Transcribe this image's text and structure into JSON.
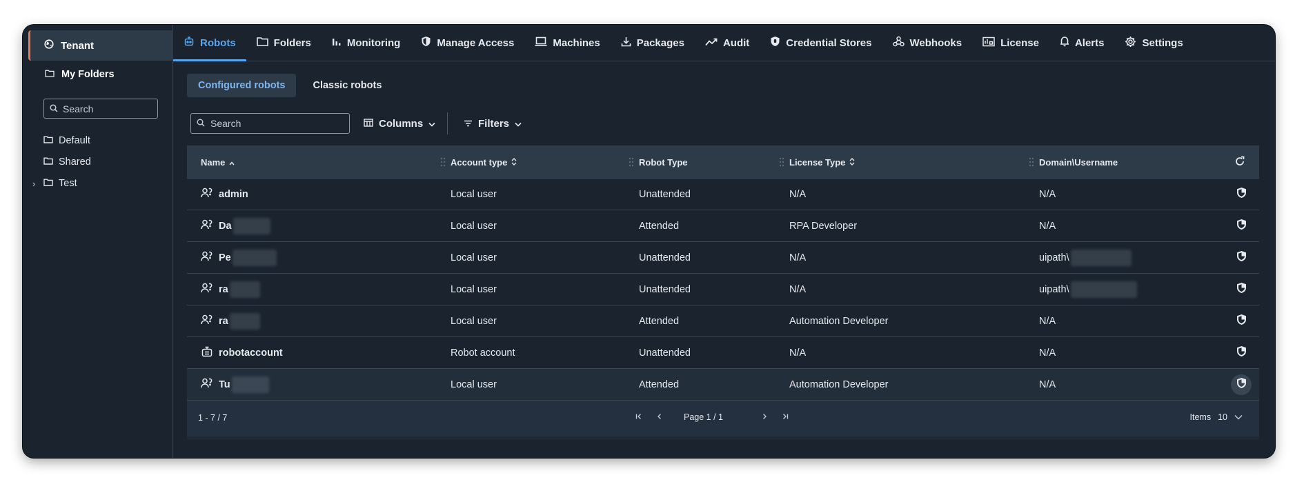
{
  "sidebar": {
    "tenant_label": "Tenant",
    "my_folders_label": "My Folders",
    "search_placeholder": "Search",
    "folders": [
      {
        "label": "Default",
        "expandable": false
      },
      {
        "label": "Shared",
        "expandable": false
      },
      {
        "label": "Test",
        "expandable": true
      }
    ]
  },
  "topnav": {
    "tabs": [
      {
        "label": "Robots",
        "icon": "robot-icon",
        "active": true
      },
      {
        "label": "Folders",
        "icon": "folder-icon",
        "active": false
      },
      {
        "label": "Monitoring",
        "icon": "bar-chart-icon",
        "active": false
      },
      {
        "label": "Manage Access",
        "icon": "shield-icon",
        "active": false
      },
      {
        "label": "Machines",
        "icon": "laptop-icon",
        "active": false
      },
      {
        "label": "Packages",
        "icon": "download-icon",
        "active": false
      },
      {
        "label": "Audit",
        "icon": "trend-line-icon",
        "active": false
      },
      {
        "label": "Credential Stores",
        "icon": "shield-lock-icon",
        "active": false
      },
      {
        "label": "Webhooks",
        "icon": "webhook-icon",
        "active": false
      },
      {
        "label": "License",
        "icon": "license-icon",
        "active": false
      },
      {
        "label": "Alerts",
        "icon": "bell-icon",
        "active": false
      },
      {
        "label": "Settings",
        "icon": "gear-icon",
        "active": false
      }
    ]
  },
  "subtabs": [
    {
      "label": "Configured robots",
      "active": true
    },
    {
      "label": "Classic robots",
      "active": false
    }
  ],
  "toolbar": {
    "search_placeholder": "Search",
    "columns_label": "Columns",
    "filters_label": "Filters"
  },
  "table": {
    "headers": {
      "name": "Name",
      "account_type": "Account type",
      "robot_type": "Robot Type",
      "license_type": "License Type",
      "domain_username": "Domain\\Username"
    },
    "rows": [
      {
        "name": "admin",
        "account_type": "Local user",
        "robot_type": "Unattended",
        "license_type": "N/A",
        "domain_username": "N/A",
        "icon": "user-group-icon"
      },
      {
        "name": "Da",
        "account_type": "Local user",
        "robot_type": "Attended",
        "license_type": "RPA Developer",
        "domain_username": "N/A",
        "icon": "user-group-icon"
      },
      {
        "name": "Pe",
        "account_type": "Local user",
        "robot_type": "Unattended",
        "license_type": "N/A",
        "domain_username": "uipath\\",
        "icon": "user-group-icon"
      },
      {
        "name": "ra",
        "account_type": "Local user",
        "robot_type": "Unattended",
        "license_type": "N/A",
        "domain_username": "uipath\\",
        "icon": "user-group-icon"
      },
      {
        "name": "ra",
        "account_type": "Local user",
        "robot_type": "Attended",
        "license_type": "Automation Developer",
        "domain_username": "N/A",
        "icon": "user-group-icon"
      },
      {
        "name": "robotaccount",
        "account_type": "Robot account",
        "robot_type": "Unattended",
        "license_type": "N/A",
        "domain_username": "N/A",
        "icon": "robot-icon"
      },
      {
        "name": "Tu",
        "account_type": "Local user",
        "robot_type": "Attended",
        "license_type": "Automation Developer",
        "domain_username": "N/A",
        "icon": "user-group-icon"
      }
    ]
  },
  "footer": {
    "range": "1 - 7 / 7",
    "page": "Page 1 / 1",
    "items_label": "Items",
    "items_value": "10"
  },
  "colors": {
    "accent": "#5aa5ef",
    "tenant_marker": "#e07a52",
    "background": "#1a232e"
  }
}
